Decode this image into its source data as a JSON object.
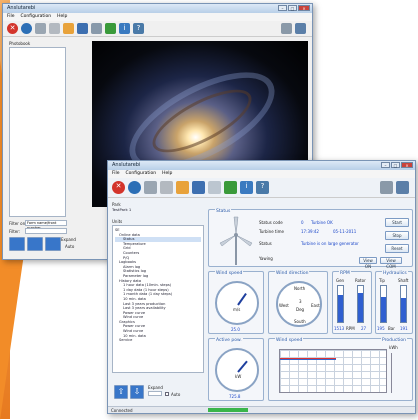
{
  "back_window": {
    "title": "Anslutarebi",
    "menu": [
      "File",
      "Configuration",
      "Help"
    ],
    "photobook_label": "Photobook",
    "filter_label": "Filter on:",
    "filter_value": "Form name/front number",
    "filter2_label": "Filter:",
    "expand_label": "Expand",
    "auto_label": "Auto"
  },
  "front_window": {
    "title": "Anslutarebi",
    "menu": [
      "File",
      "Configuration",
      "Help"
    ],
    "park_label": "Park",
    "park_value": "TestPark 1",
    "units_label": "Units",
    "tree": [
      "SE",
      "Online data",
      "Status",
      "Temperature",
      "Grid",
      "Counters",
      "P/Q",
      "Logbooks",
      "Alarm log",
      "Statistics log",
      "Parameter log",
      "History data",
      "1 hour data (10min. steps)",
      "1 day data (1 hour steps)",
      "1 month data (1 day steps)",
      "10 min. data",
      "Last 3 years production",
      "Last 3 years availability",
      "Power curve",
      "Wind curve",
      "Graphics",
      "Power curve",
      "Wind curve",
      "10 min. data",
      "Service"
    ],
    "status": {
      "title": "Status",
      "status_code_label": "Status code",
      "status_code_value": "0",
      "status_code_text": "Turbine OK",
      "turbine_time_label": "Turbine time",
      "turbine_time_value": "17:39:42",
      "turbine_date_value": "05-11-2011",
      "status_label": "Status",
      "status_text": "Turbine is on large generator",
      "yawing_label": "Yawing",
      "view_on": "View ON",
      "view_com": "View COM",
      "start": "Start",
      "stop": "Stop",
      "reset": "Reset"
    },
    "wind_speed": {
      "title": "Wind speed",
      "unit": "m/s",
      "value": "25.0"
    },
    "wind_direction": {
      "title": "Wind direction",
      "north": "North",
      "south": "South",
      "east": "East",
      "west": "West",
      "value": "3",
      "unit": "Deg"
    },
    "rpm": {
      "title": "RPM",
      "gen": "Gen",
      "rotor": "Rotor",
      "gen_value": "1513",
      "rotor_value": "27",
      "unit": "RPM"
    },
    "hydraulics": {
      "title": "Hydraulics",
      "tip": "Tip",
      "shaft": "Shaft",
      "tip_value": "195",
      "shaft_value": "191",
      "unit": "Bar"
    },
    "active_power": {
      "title": "Active pow.",
      "unit": "kW",
      "value": "725.8"
    },
    "wind_speed_chart": {
      "title": "Wind speed"
    },
    "production": {
      "title": "Production",
      "unit": "kWh"
    },
    "expand_label": "Expand",
    "auto_label": "Auto",
    "footer_left": "Connected"
  }
}
